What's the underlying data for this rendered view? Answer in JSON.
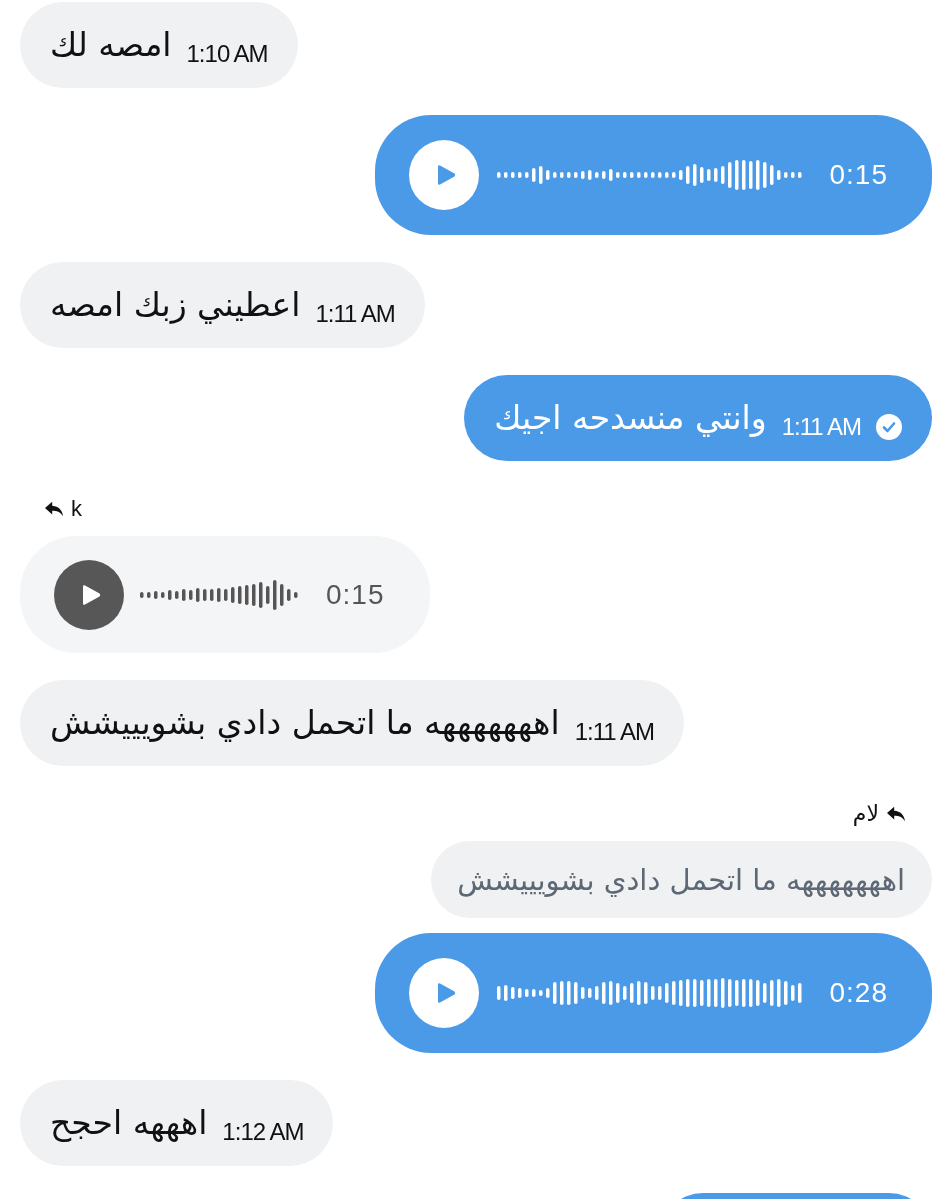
{
  "messages": [
    {
      "kind": "text",
      "outgoing": false,
      "text": "امصه لك",
      "time": "1:10 AM",
      "check": false
    },
    {
      "kind": "voice",
      "outgoing": true,
      "duration": "0:15"
    },
    {
      "kind": "text",
      "outgoing": false,
      "text": "اعطيني زبك امصه",
      "time": "1:11 AM",
      "check": false
    },
    {
      "kind": "text",
      "outgoing": true,
      "text": "وانتي منسدحه اجيك",
      "time": "1:11 AM",
      "check": true
    },
    {
      "kind": "voice",
      "outgoing": false,
      "duration": "0:15",
      "reply_to": {
        "name": "k"
      }
    },
    {
      "kind": "text",
      "outgoing": false,
      "text": "اهههههههه ما اتحمل دادي بشويييشش",
      "time": "1:11 AM",
      "check": false
    },
    {
      "kind": "voice",
      "outgoing": true,
      "duration": "0:28",
      "reply_to": {
        "name": "لام",
        "quote": "اهههههههه ما اتحمل دادي بشويييشش"
      }
    },
    {
      "kind": "text",
      "outgoing": false,
      "text": "اهههه احجح",
      "time": "1:12 AM",
      "check": false
    },
    {
      "kind": "clipped",
      "outgoing": true
    }
  ]
}
